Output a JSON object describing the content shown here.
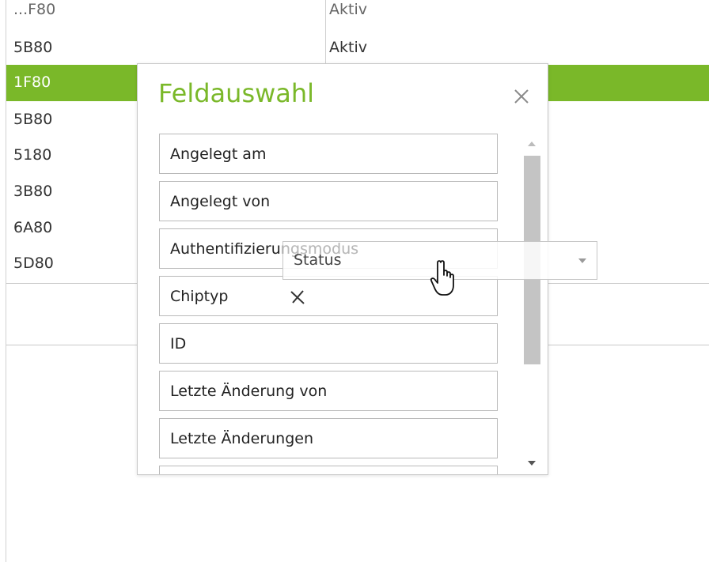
{
  "background_table": {
    "rows": [
      {
        "id": "...F80",
        "status": "Aktiv"
      },
      {
        "id": "5B80",
        "status": "Aktiv"
      },
      {
        "id": "1F80",
        "status": ""
      },
      {
        "id": "5B80",
        "status": ""
      },
      {
        "id": "5180",
        "status": ""
      },
      {
        "id": "3B80",
        "status": ""
      },
      {
        "id": "6A80",
        "status": ""
      },
      {
        "id": "5D80",
        "status": ""
      }
    ],
    "selected_index": 2,
    "accent_color": "#7ab829"
  },
  "dialog": {
    "title": "Feldauswahl",
    "close_icon": "close-icon",
    "fields": [
      {
        "label": "Angelegt am"
      },
      {
        "label": "Angelegt von"
      },
      {
        "label": "Authentifizierungsmodus"
      },
      {
        "label": "Chiptyp"
      },
      {
        "label": "ID"
      },
      {
        "label": "Letzte Änderung von"
      },
      {
        "label": "Letzte Änderungen"
      },
      {
        "label": ""
      }
    ]
  },
  "drag": {
    "ghost_label": "Status",
    "faded_text": "ngsmodus",
    "icon": "chevron-down-icon",
    "cursor_icon": "hand-pointer-icon"
  }
}
